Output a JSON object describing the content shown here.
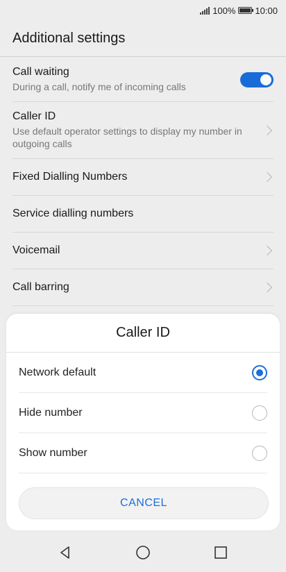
{
  "status_bar": {
    "battery_text": "100%",
    "time": "10:00"
  },
  "header": {
    "title": "Additional settings"
  },
  "settings": [
    {
      "title": "Call waiting",
      "subtitle": "During a call, notify me of incoming calls",
      "control": "toggle",
      "toggle_on": true
    },
    {
      "title": "Caller ID",
      "subtitle": "Use default operator settings to display my number in outgoing calls",
      "control": "chevron"
    },
    {
      "title": "Fixed Dialling Numbers",
      "subtitle": "",
      "control": "chevron"
    },
    {
      "title": "Service dialling numbers",
      "subtitle": "",
      "control": "none"
    },
    {
      "title": "Voicemail",
      "subtitle": "",
      "control": "chevron"
    },
    {
      "title": "Call barring",
      "subtitle": "",
      "control": "chevron"
    }
  ],
  "dialog": {
    "title": "Caller ID",
    "options": [
      {
        "label": "Network default",
        "selected": true
      },
      {
        "label": "Hide number",
        "selected": false
      },
      {
        "label": "Show number",
        "selected": false
      }
    ],
    "cancel_label": "CANCEL"
  },
  "nav_bar": {
    "icons": [
      "back-icon",
      "home-icon",
      "recents-icon"
    ]
  },
  "colors": {
    "accent": "#1a6fdd",
    "background": "#f2f2f2"
  }
}
